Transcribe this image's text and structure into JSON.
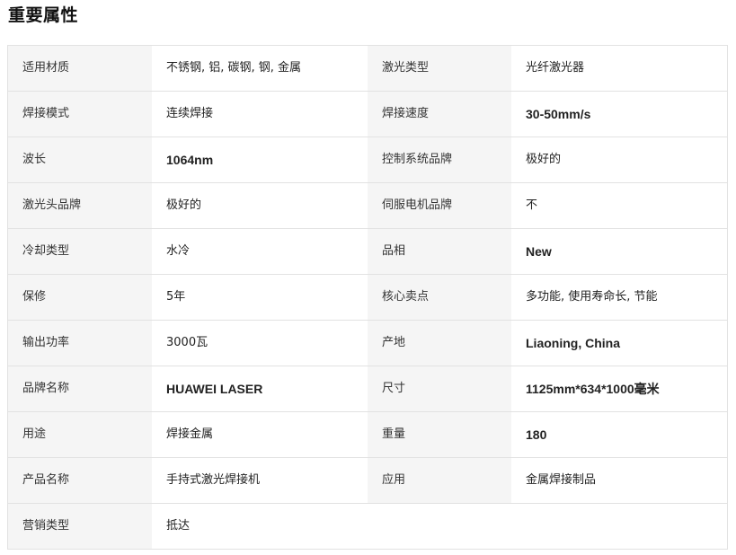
{
  "section": {
    "title": "重要属性"
  },
  "rows": [
    {
      "l1": "适用材质",
      "v1": "不锈钢, 铝, 碳钢, 钢, 金属",
      "l2": "激光类型",
      "v2": "光纤激光器"
    },
    {
      "l1": "焊接模式",
      "v1": "连续焊接",
      "l2": "焊接速度",
      "v2": "30-50mm/s"
    },
    {
      "l1": "波长",
      "v1": "1064nm",
      "l2": "控制系统品牌",
      "v2": "极好的"
    },
    {
      "l1": "激光头品牌",
      "v1": "极好的",
      "l2": "伺服电机品牌",
      "v2": "不"
    },
    {
      "l1": "冷却类型",
      "v1": "水冷",
      "l2": "品相",
      "v2": "New"
    },
    {
      "l1": "保修",
      "v1": "5年",
      "l2": "核心卖点",
      "v2": "多功能, 使用寿命长, 节能"
    },
    {
      "l1": "输出功率",
      "v1": "3000瓦",
      "l2": "产地",
      "v2": "Liaoning, China"
    },
    {
      "l1": "品牌名称",
      "v1": "HUAWEI LASER",
      "l2": "尺寸",
      "v2": "1125mm*634*1000毫米"
    },
    {
      "l1": "用途",
      "v1": "焊接金属",
      "l2": "重量",
      "v2": "180"
    },
    {
      "l1": "产品名称",
      "v1": "手持式激光焊接机",
      "l2": "应用",
      "v2": "金属焊接制品"
    },
    {
      "l1": "营销类型",
      "v1": "抵达",
      "l2": "",
      "v2": ""
    }
  ]
}
